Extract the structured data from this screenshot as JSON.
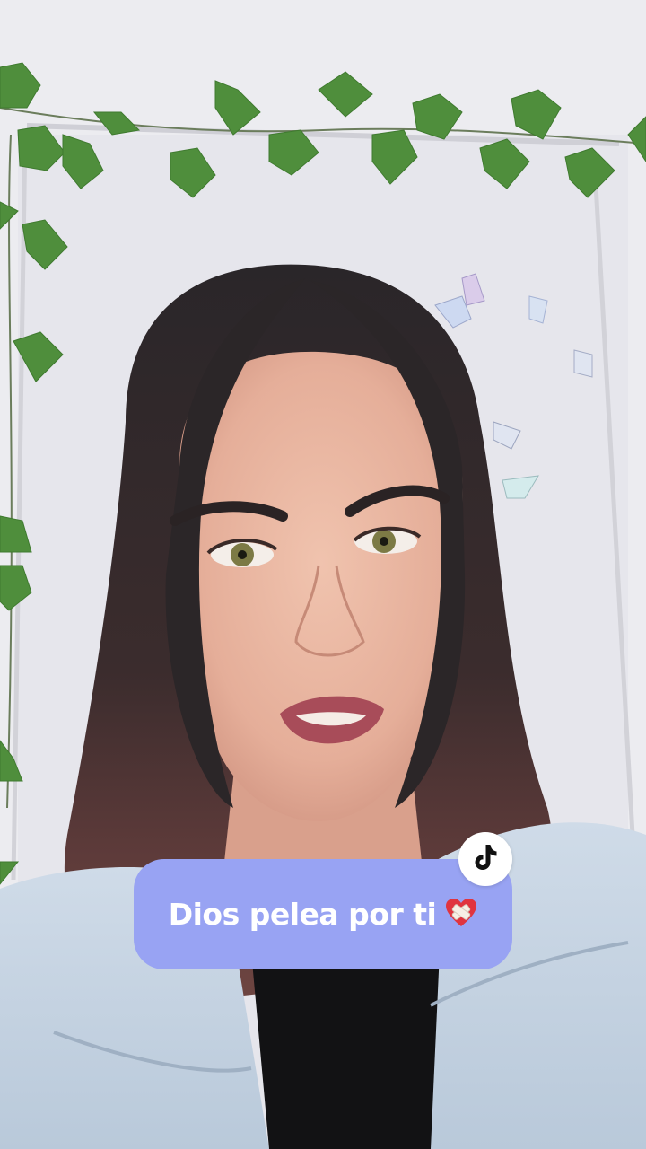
{
  "caption": {
    "text": "Dios pelea por ti",
    "emoji_icon": "mending-heart-icon",
    "background_color": "#98a3f3",
    "text_color": "#ffffff"
  },
  "badge": {
    "icon": "tiktok-logo-icon",
    "background_color": "#ffffff"
  },
  "photo": {
    "subject": "woman-speaking-to-camera"
  }
}
